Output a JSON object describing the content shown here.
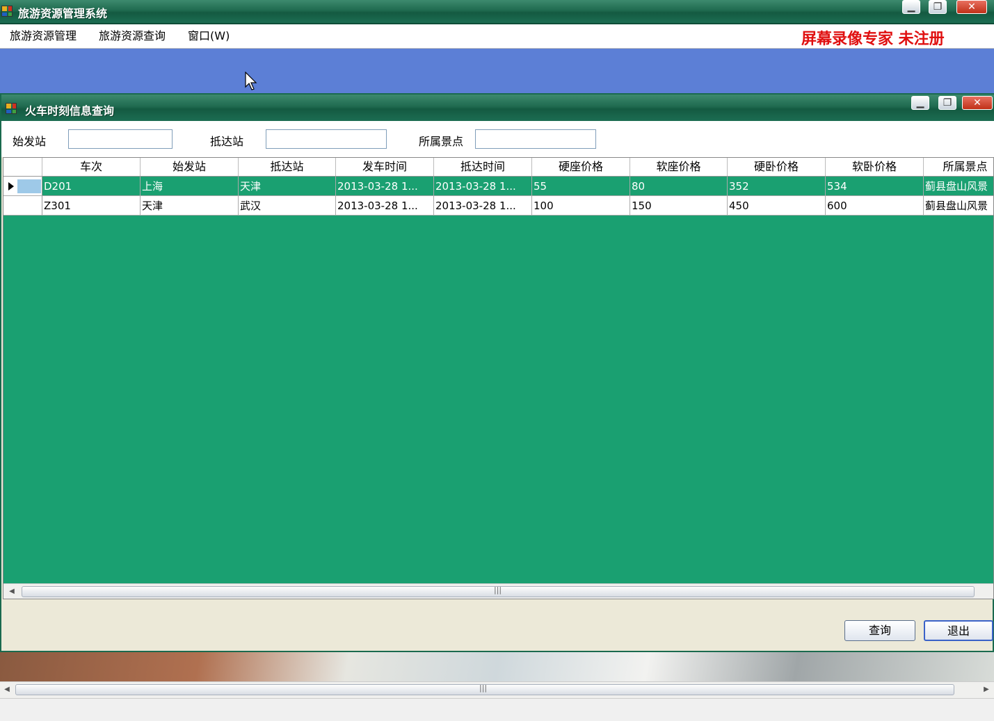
{
  "app": {
    "title": "旅游资源管理系统",
    "menu": [
      "旅游资源管理",
      "旅游资源查询",
      "窗口(W)"
    ],
    "watermark": "屏幕录像专家  未注册"
  },
  "child": {
    "title": "火车时刻信息查询",
    "filters": {
      "start_label": "始发站",
      "start_value": "",
      "end_label": "抵达站",
      "end_value": "",
      "scenic_label": "所属景点",
      "scenic_value": ""
    },
    "columns": [
      "车次",
      "始发站",
      "抵达站",
      "发车时间",
      "抵达时间",
      "硬座价格",
      "软座价格",
      "硬卧价格",
      "软卧价格",
      "所属景点"
    ],
    "rows": [
      [
        "D201",
        "上海",
        "天津",
        "2013-03-28 1...",
        "2013-03-28 1...",
        "55",
        "80",
        "352",
        "534",
        "蓟县盘山风景"
      ],
      [
        "Z301",
        "天津",
        "武汉",
        "2013-03-28 1...",
        "2013-03-28 1...",
        "100",
        "150",
        "450",
        "600",
        "蓟县盘山风景"
      ]
    ],
    "buttons": {
      "query": "查询",
      "exit": "退出"
    }
  },
  "icons": {
    "window_minimize": "minimize-icon",
    "window_maximize": "maximize-icon",
    "window_close": "close-icon"
  }
}
